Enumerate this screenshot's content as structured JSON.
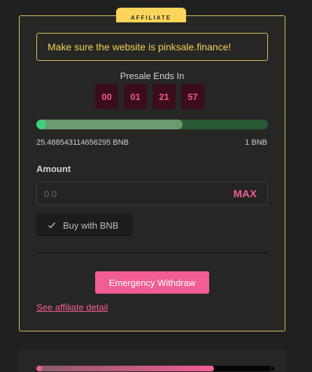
{
  "ribbon": {
    "text": "AFFILIATE",
    "icon": "percent-icon"
  },
  "warning": {
    "text": "Make sure the website is pinksale.finance!"
  },
  "presale": {
    "label": "Presale Ends In",
    "countdown": [
      "00",
      "01",
      "21",
      "57"
    ]
  },
  "progress": {
    "raised": "25.488543114656295 BNB",
    "cap": "1 BNB",
    "fraction": 0.63
  },
  "amount": {
    "label": "Amount",
    "placeholder": "0.0",
    "max_label": "MAX"
  },
  "buy": {
    "label": "Buy with BNB",
    "icon": "check-icon"
  },
  "emergency": {
    "label": "Emergency Withdraw"
  },
  "affiliate": {
    "link_text": "See affiliate detail"
  },
  "next_card": {
    "progress_fraction": 0.75
  },
  "colors": {
    "accent_pink": "#f25d95",
    "border_gold": "#e3c45a",
    "progress_green": "#275a33",
    "countdown_bg": "#3a0d1a"
  }
}
